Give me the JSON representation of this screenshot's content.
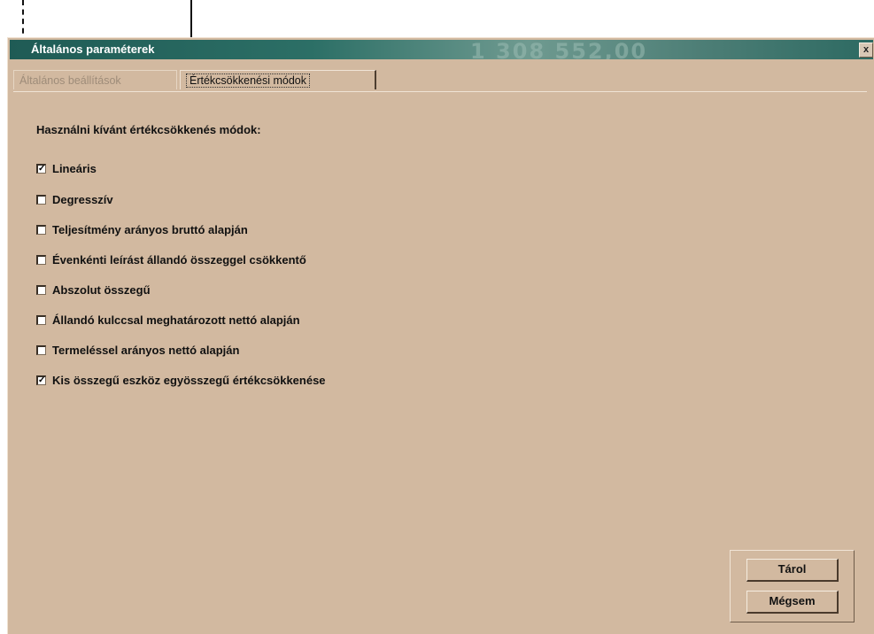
{
  "window": {
    "title": "Általános paraméterek",
    "title_background_text": "1 308 552,00",
    "close_label": "x"
  },
  "tabs": [
    {
      "label": "Általános beállítások",
      "active": false
    },
    {
      "label": "Értékcsökkenési módok",
      "active": true
    }
  ],
  "section": {
    "label": "Használni kívánt értékcsökkenés módok:"
  },
  "options": [
    {
      "label": "Lineáris",
      "checked": true
    },
    {
      "label": "Degresszív",
      "checked": false
    },
    {
      "label": "Teljesítmény arányos bruttó alapján",
      "checked": false
    },
    {
      "label": "Évenkénti leírást állandó összeggel csökkentő",
      "checked": false
    },
    {
      "label": "Abszolut összegű",
      "checked": false
    },
    {
      "label": "Állandó kulccsal meghatározott nettó alapján",
      "checked": false
    },
    {
      "label": "Termeléssel arányos nettó alapján",
      "checked": false
    },
    {
      "label": "Kis összegű eszköz egyösszegű értékcsökkenése",
      "checked": true
    }
  ],
  "buttons": {
    "save_label": "Tárol",
    "cancel_label": "Mégsem"
  },
  "colors": {
    "window_bg": "#d2b9a0",
    "titlebar": "#2c6f66",
    "title_text": "#ffffff"
  }
}
